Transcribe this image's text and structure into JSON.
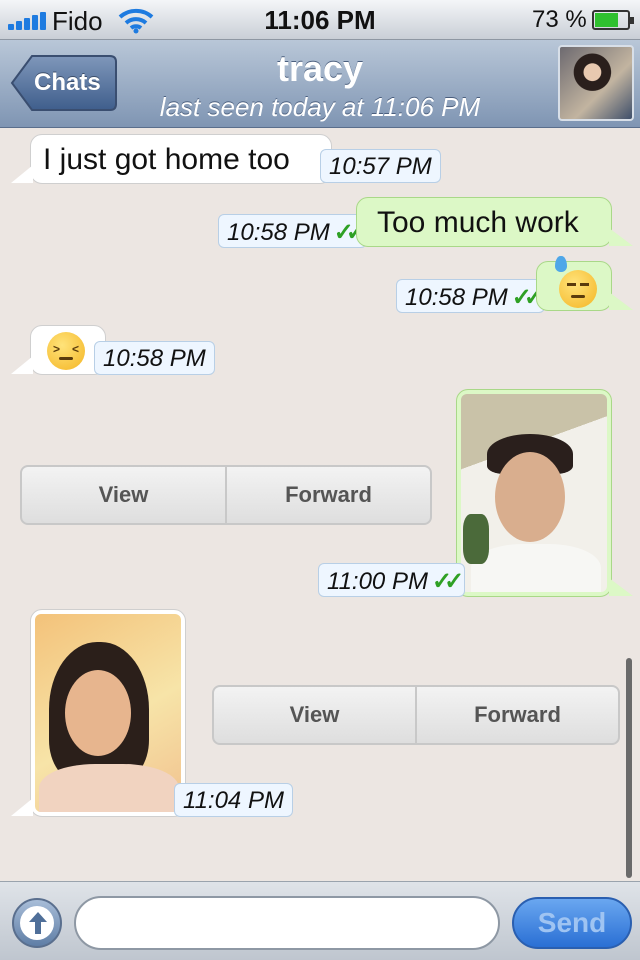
{
  "status_bar": {
    "carrier": "Fido",
    "time": "11:06 PM",
    "battery_percent": "73 %",
    "battery_level": 0.73,
    "icons": [
      "signal-icon",
      "wifi-icon",
      "battery-icon"
    ]
  },
  "nav": {
    "back_label": "Chats",
    "title": "tracy",
    "subtitle": "last seen today at 11:06 PM"
  },
  "messages": [
    {
      "direction": "in",
      "text": "I just got home too",
      "time": "10:57 PM"
    },
    {
      "direction": "out",
      "text": "Too much work",
      "time": "10:58 PM",
      "status": "read"
    },
    {
      "direction": "out",
      "emoji": "cold-sweat-face",
      "time": "10:58 PM",
      "status": "read"
    },
    {
      "direction": "in",
      "emoji": "confounded-face",
      "time": "10:58 PM"
    },
    {
      "direction": "out",
      "media": "photo",
      "time": "11:00 PM",
      "status": "read",
      "actions": [
        "View",
        "Forward"
      ]
    },
    {
      "direction": "in",
      "media": "photo",
      "time": "11:04 PM",
      "actions": [
        "View",
        "Forward"
      ]
    }
  ],
  "input": {
    "placeholder": "",
    "value": "",
    "send_label": "Send"
  },
  "colors": {
    "incoming_bubble": "#ffffff",
    "outgoing_bubble": "#dcf8c6",
    "nav_bar": "#8fa3bf",
    "read_check": "#2ea024",
    "chat_background": "#ece6e2"
  }
}
